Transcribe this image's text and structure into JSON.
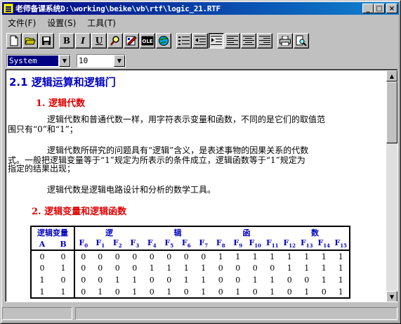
{
  "window": {
    "title": "老师备课系统D:\\working\\beike\\vb\\rtf\\logic_21.RTF",
    "minimize_glyph": "_",
    "maximize_glyph": "□",
    "close_glyph": "×"
  },
  "menu": {
    "items": [
      "文件(F)",
      "设置(S)",
      "工具(T)"
    ]
  },
  "toolbar": {
    "bold": "B",
    "italic": "I",
    "underline": "U"
  },
  "format": {
    "font_name": "System",
    "font_size": "10"
  },
  "document": {
    "heading": "2.1 逻辑运算和逻辑门",
    "section1_title": "1. 逻辑代数",
    "para1_line1": "逻辑代数和普通代数一样，用字符表示变量和函数，不同的是它们的取值范",
    "para1_line2": "围只有“0”和“1”；",
    "para2_line1": "逻辑代数所研究的问题具有“逻辑”含义，是表述事物的因果关系的代数",
    "para2_line2": "式。一般把逻辑变量等于“1”规定为所表示的条件成立，逻辑函数等于“1”规定为",
    "para2_line3": "指定的结果出现；",
    "para3": "逻辑代数是逻辑电路设计和分析的数学工具。",
    "section2_title": "2. 逻辑变量和逻辑函数",
    "table": {
      "var_header": "逻辑变量",
      "func_header_chars": [
        "逻",
        "辑",
        "函",
        "数"
      ],
      "var_names": [
        "A",
        "B"
      ],
      "func_prefix": "F",
      "func_indices": [
        "0",
        "1",
        "2",
        "3",
        "4",
        "5",
        "6",
        "7",
        "8",
        "9",
        "10",
        "11",
        "12",
        "13",
        "14",
        "15"
      ],
      "rows": [
        {
          "vars": [
            "0",
            "0"
          ],
          "vals": [
            "0",
            "0",
            "0",
            "0",
            "0",
            "0",
            "0",
            "0",
            "1",
            "1",
            "1",
            "1",
            "1",
            "1",
            "1",
            "1"
          ]
        },
        {
          "vars": [
            "0",
            "1"
          ],
          "vals": [
            "0",
            "0",
            "0",
            "0",
            "1",
            "1",
            "1",
            "1",
            "0",
            "0",
            "0",
            "0",
            "1",
            "1",
            "1",
            "1"
          ]
        },
        {
          "vars": [
            "1",
            "0"
          ],
          "vals": [
            "0",
            "0",
            "1",
            "1",
            "0",
            "0",
            "1",
            "1",
            "0",
            "0",
            "1",
            "1",
            "0",
            "0",
            "1",
            "1"
          ]
        },
        {
          "vars": [
            "1",
            "1"
          ],
          "vals": [
            "0",
            "1",
            "0",
            "1",
            "0",
            "1",
            "0",
            "1",
            "0",
            "1",
            "0",
            "1",
            "0",
            "1",
            "0",
            "1"
          ]
        }
      ]
    }
  }
}
